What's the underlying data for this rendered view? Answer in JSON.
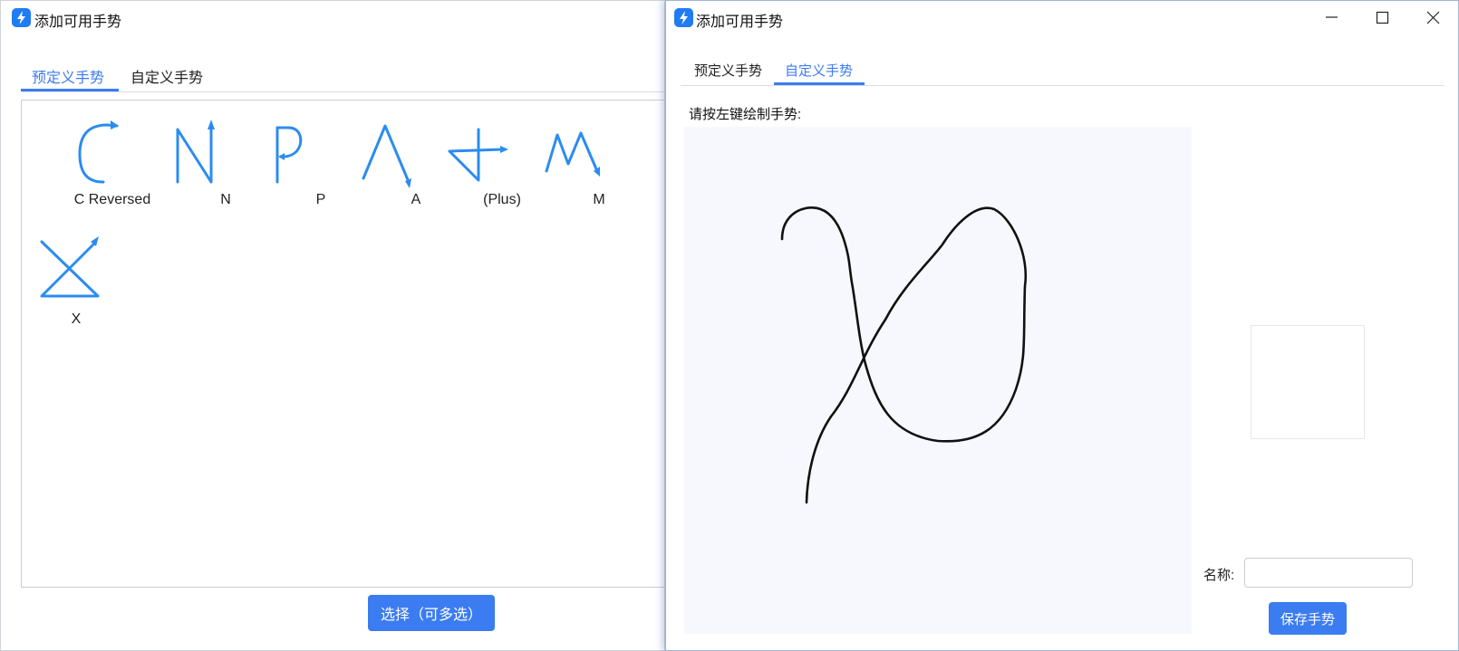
{
  "left_window": {
    "title": "添加可用手势",
    "tabs": [
      {
        "label": "预定义手势",
        "active": true
      },
      {
        "label": "自定义手势",
        "active": false
      }
    ],
    "gestures": [
      {
        "label": "C Reversed",
        "icon": "c-reversed-gesture-icon"
      },
      {
        "label": "N",
        "icon": "n-gesture-icon"
      },
      {
        "label": "P",
        "icon": "p-gesture-icon"
      },
      {
        "label": "A",
        "icon": "a-gesture-icon"
      },
      {
        "label": "(Plus)",
        "icon": "plus-gesture-icon"
      },
      {
        "label": "M",
        "icon": "m-gesture-icon"
      },
      {
        "label": "X",
        "icon": "x-gesture-icon"
      }
    ],
    "select_button": "选择（可多选）"
  },
  "right_window": {
    "title": "添加可用手势",
    "controls": [
      "minimize-icon",
      "maximize-icon",
      "close-icon"
    ],
    "tabs": [
      {
        "label": "预定义手势",
        "active": false
      },
      {
        "label": "自定义手势",
        "active": true
      }
    ],
    "hint": "请按左键绘制手势:",
    "name_label": "名称:",
    "name_value": "",
    "save_button": "保存手势"
  },
  "colors": {
    "accent": "#3b7cf0",
    "gesture_stroke": "#2b8cf0",
    "canvas_bg": "#f6f8fd",
    "app_icon": "#1f7cf2"
  }
}
